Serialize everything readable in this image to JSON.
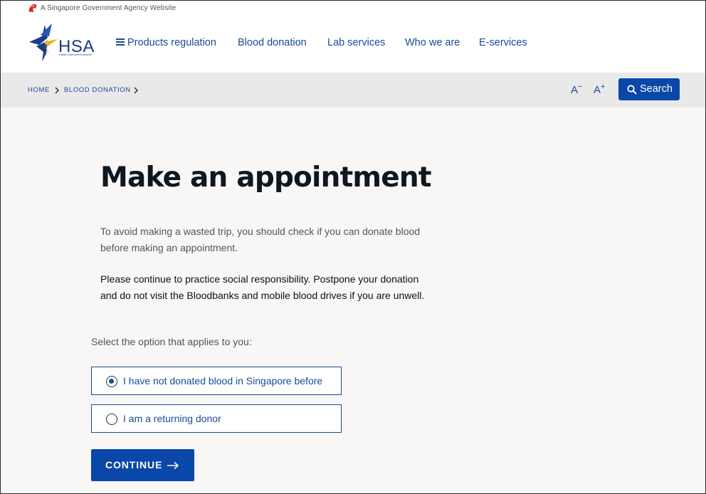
{
  "masthead": {
    "text": "A Singapore Government Agency Website"
  },
  "logo": {
    "text": "HSA",
    "subtext": "Health Sciences Authority"
  },
  "nav": {
    "items": [
      {
        "label": "Products regulation"
      },
      {
        "label": "Blood donation"
      },
      {
        "label": "Lab services"
      },
      {
        "label": "Who we are"
      },
      {
        "label": "E-services"
      }
    ]
  },
  "breadcrumb": {
    "items": [
      "HOME",
      "BLOOD DONATION"
    ]
  },
  "font_controls": {
    "decrease": "A",
    "decrease_sup": "−",
    "increase": "A",
    "increase_sup": "+"
  },
  "search": {
    "label": "Search"
  },
  "main": {
    "title": "Make an appointment",
    "para1": "To avoid making a wasted trip, you should check if you can donate blood before making an appointment.",
    "para2": "Please continue to practice social responsibility. Postpone your donation and do not visit the Bloodbanks and mobile blood drives if you are unwell.",
    "select_label": "Select the option that applies to you:",
    "options": [
      {
        "label": "I have not donated blood in Singapore before",
        "checked": true
      },
      {
        "label": "I am a returning donor",
        "checked": false
      }
    ],
    "continue_label": "CONTINUE"
  },
  "colors": {
    "brand_blue": "#0a47a9",
    "link_blue": "#1a4a96",
    "crumb_bg": "#e9e9ea",
    "page_bg": "#f8f7f5"
  }
}
